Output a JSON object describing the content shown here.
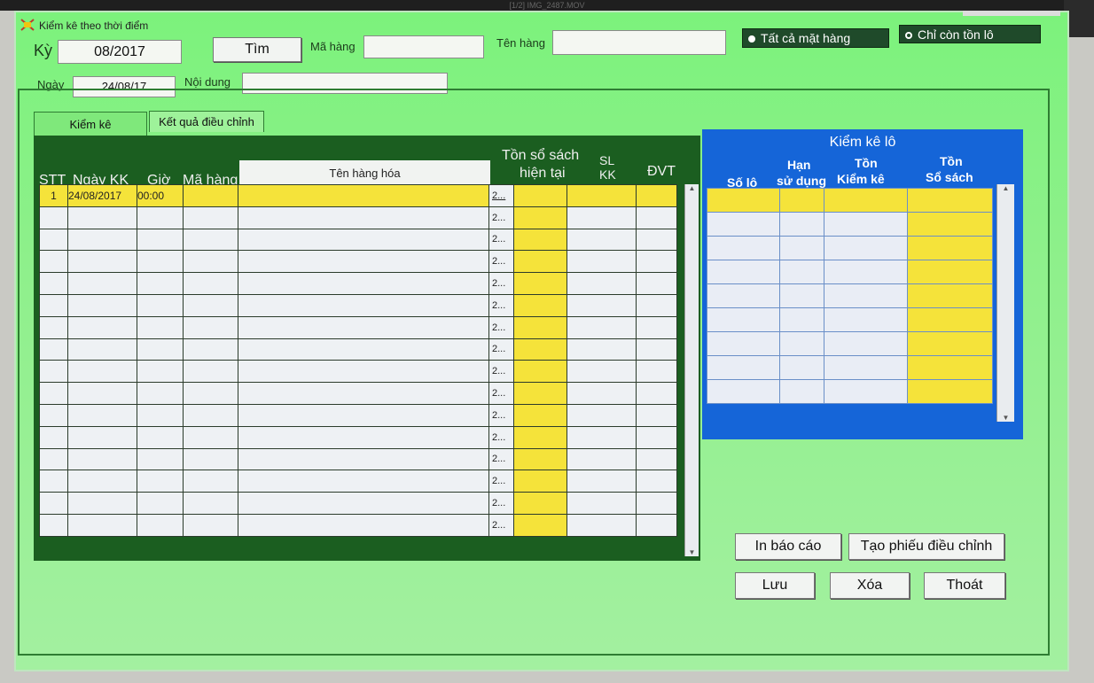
{
  "topbar": {
    "text": "[1/2] IMG_2487.MOV"
  },
  "window": {
    "title": "Kiểm kê theo thời điểm"
  },
  "filters": {
    "ky_label": "Kỳ",
    "ky_value": "08/2017",
    "tim_label": "Tìm",
    "ma_hang_label": "Mã hàng",
    "ma_hang_value": "",
    "ten_hang_label": "Tên hàng",
    "ten_hang_value": "",
    "radio_all": "Tất cả mặt hàng",
    "radio_stock": "Chỉ còn tồn lô",
    "ngay_label": "Ngày",
    "ngay_value": "24/08/17",
    "noi_dung_label": "Nội dung",
    "noi_dung_value": ""
  },
  "tabs": [
    {
      "label": "Kiểm kê"
    },
    {
      "label": "Kết quả điều chỉnh"
    }
  ],
  "grid": {
    "headers": {
      "stt": "STT",
      "ngay": "Ngày KK",
      "gio": "Giờ",
      "ma_hang": "Mã hàng",
      "ten_hang": "Tên hàng hóa",
      "ton_so_sach": "Tồn sổ sách",
      "hien_tai": "hiện tại",
      "sl": "SL",
      "kk": "KK",
      "dvt": "ĐVT"
    },
    "rows": [
      {
        "stt": "1",
        "ngay": "24/08/2017",
        "gio": "00:00",
        "ma": "",
        "ten": "",
        "c": "2..."
      },
      {
        "c": "2..."
      },
      {
        "c": "2..."
      },
      {
        "c": "2..."
      },
      {
        "c": "2..."
      },
      {
        "c": "2..."
      },
      {
        "c": "2..."
      },
      {
        "c": "2..."
      },
      {
        "c": "2..."
      },
      {
        "c": "2..."
      },
      {
        "c": "2..."
      },
      {
        "c": "2..."
      },
      {
        "c": "2..."
      },
      {
        "c": "2..."
      },
      {
        "c": "2..."
      },
      {
        "c": "2..."
      }
    ]
  },
  "lot": {
    "title": "Kiểm kê lô",
    "headers": {
      "so_lo": "Số lô",
      "han": "Hạn",
      "su_dung": "sử dụng",
      "ton1": "Tồn",
      "kiem_ke": "Kiểm kê",
      "ton2": "Tồn",
      "so_sach": "Sổ sách"
    },
    "row_count": 9
  },
  "buttons": {
    "in_bao_cao": "In báo cáo",
    "tao_phieu": "Tạo phiếu điều chỉnh",
    "luu": "Lưu",
    "xoa": "Xóa",
    "thoat": "Thoát"
  },
  "colors": {
    "window_bg": "#8ff08c",
    "grid_bg": "#1b5e20",
    "lot_bg": "#1565d8",
    "highlight": "#f5e33a"
  }
}
